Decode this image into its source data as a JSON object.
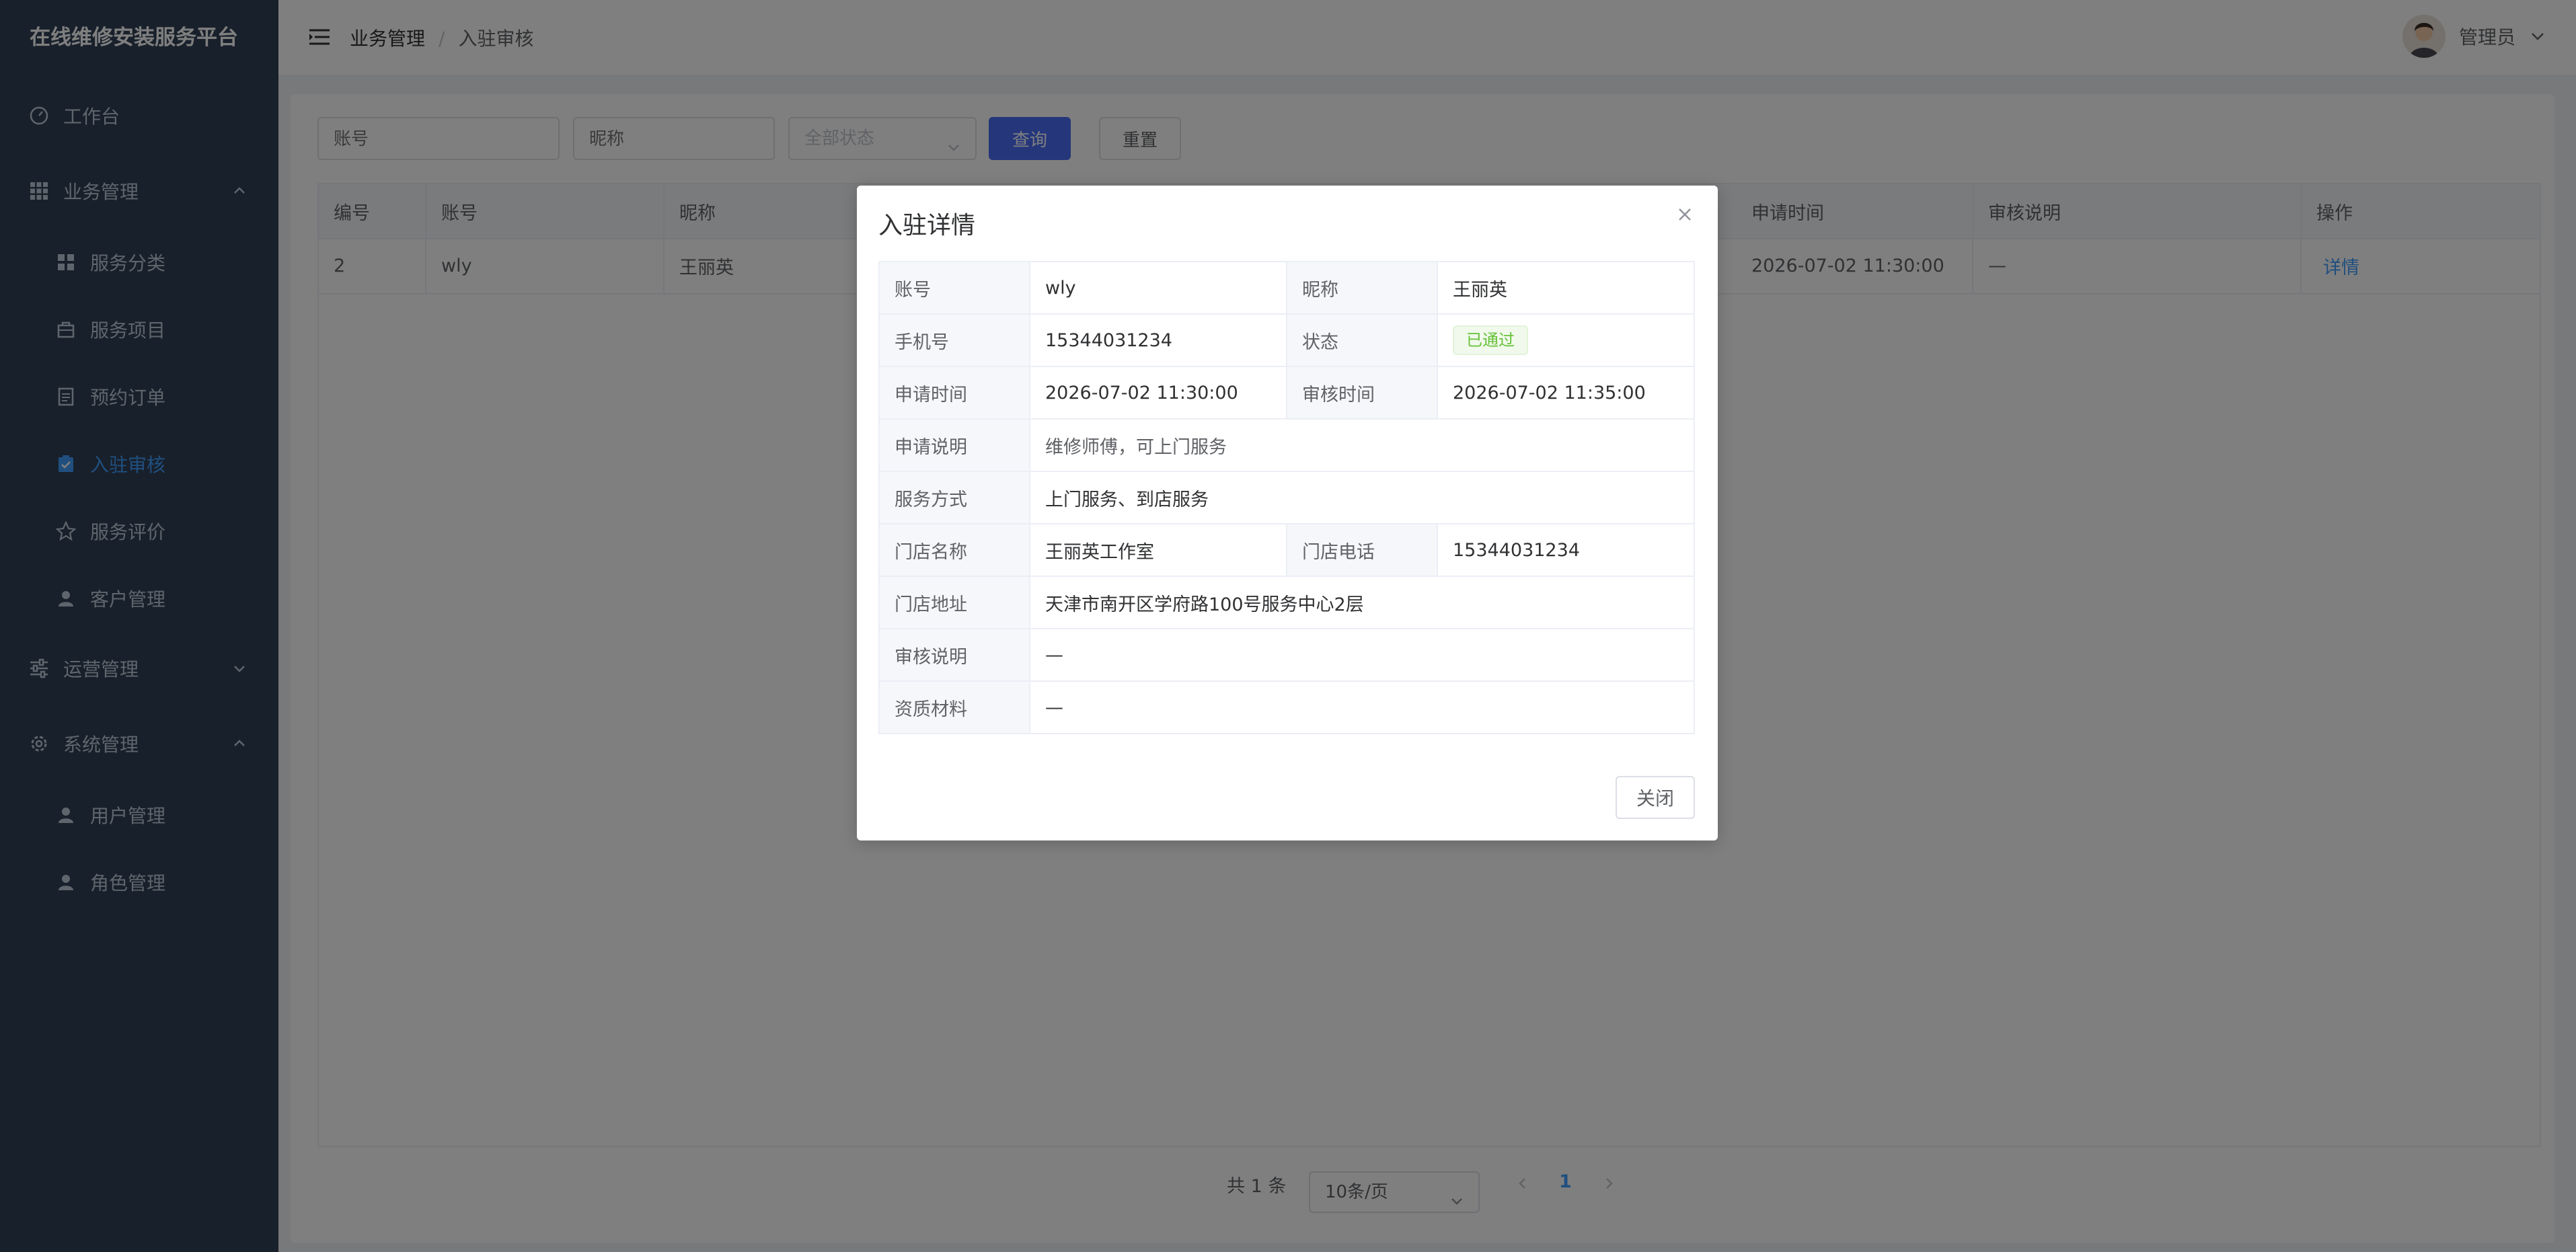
{
  "app": {
    "title": "在线维修安装服务平台"
  },
  "sidebar": {
    "items": [
      {
        "label": "工作台",
        "icon": "dashboard-icon"
      },
      {
        "label": "业务管理",
        "icon": "grid-icon",
        "expanded": true
      },
      {
        "label": "服务分类",
        "icon": "category-icon"
      },
      {
        "label": "服务项目",
        "icon": "bag-icon"
      },
      {
        "label": "预约订单",
        "icon": "document-icon"
      },
      {
        "label": "入驻审核",
        "icon": "checked-clipboard-icon",
        "active": true
      },
      {
        "label": "服务评价",
        "icon": "star-icon"
      },
      {
        "label": "客户管理",
        "icon": "user-icon"
      },
      {
        "label": "运营管理",
        "icon": "sliders-icon",
        "expanded": false
      },
      {
        "label": "系统管理",
        "icon": "gear-icon",
        "expanded": true
      },
      {
        "label": "用户管理",
        "icon": "user-icon"
      },
      {
        "label": "角色管理",
        "icon": "user-icon"
      }
    ]
  },
  "header": {
    "breadcrumb": [
      "业务管理",
      "入驻审核"
    ],
    "separator": "/",
    "user": "管理员"
  },
  "filters": {
    "account_placeholder": "账号",
    "nickname_placeholder": "昵称",
    "status_value": "全部状态",
    "query_label": "查询",
    "reset_label": "重置"
  },
  "table": {
    "columns": [
      "编号",
      "账号",
      "昵称",
      "申请时间",
      "审核说明",
      "操作"
    ],
    "rows": [
      {
        "id": "2",
        "account": "wly",
        "nickname": "王丽英",
        "apply_time": "2026-07-02 11:30:00",
        "review_note": "—",
        "action": "详情"
      }
    ]
  },
  "pagination": {
    "total": "共 1 条",
    "page_size": "10条/页",
    "current_page": "1"
  },
  "dialog": {
    "title": "入驻详情",
    "fields": {
      "account_label": "账号",
      "account": "wly",
      "nickname_label": "昵称",
      "nickname": "王丽英",
      "phone_label": "手机号",
      "phone": "15344031234",
      "status_label": "状态",
      "status": "已通过",
      "apply_time_label": "申请时间",
      "apply_time": "2026-07-02 11:30:00",
      "review_time_label": "审核时间",
      "review_time": "2026-07-02 11:35:00",
      "apply_note_label": "申请说明",
      "apply_note": "维修师傅，可上门服务",
      "service_mode_label": "服务方式",
      "service_mode": "上门服务、到店服务",
      "store_name_label": "门店名称",
      "store_name": "王丽英工作室",
      "store_phone_label": "门店电话",
      "store_phone": "15344031234",
      "store_address_label": "门店地址",
      "store_address": "天津市南开区学府路100号服务中心2层",
      "review_note_label": "审核说明",
      "review_note": "—",
      "qualification_label": "资质材料",
      "qualification": "—"
    },
    "close_label": "关闭"
  },
  "colors": {
    "sidebar_bg": "#304156",
    "active": "#409eff",
    "primary_button": "#4a6cf7",
    "success_tag": "#67c23a"
  }
}
